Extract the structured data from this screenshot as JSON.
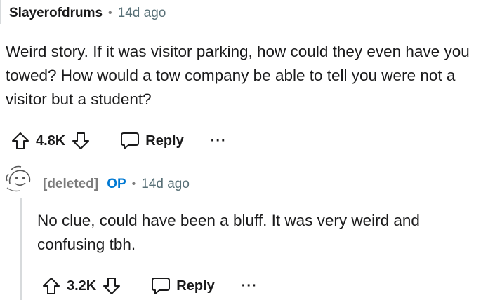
{
  "comments": [
    {
      "author": "Slayerofdrums",
      "separator": "•",
      "time": "14d ago",
      "body": "Weird story. If it was visitor parking, how could they even have you towed? How would a tow company be able to tell you were not a visitor but a student?",
      "score": "4.8K",
      "reply_label": "Reply",
      "more_label": "···"
    },
    {
      "author": "[deleted]",
      "op_badge": "OP",
      "separator": "•",
      "time": "14d ago",
      "body": "No clue, could have been a bluff. It was very weird and confusing tbh.",
      "score": "3.2K",
      "reply_label": "Reply",
      "more_label": "···"
    }
  ],
  "icons": {
    "upvote": "arrow-up-icon",
    "downvote": "arrow-down-icon",
    "reply": "speech-bubble-icon",
    "more": "more-horizontal-icon",
    "avatar": "snoo-avatar-icon"
  },
  "colors": {
    "op_badge": "#0079d3",
    "deleted_author": "#7c7c7c",
    "meta_text": "#576f76",
    "thread_line": "#d7dadc"
  }
}
